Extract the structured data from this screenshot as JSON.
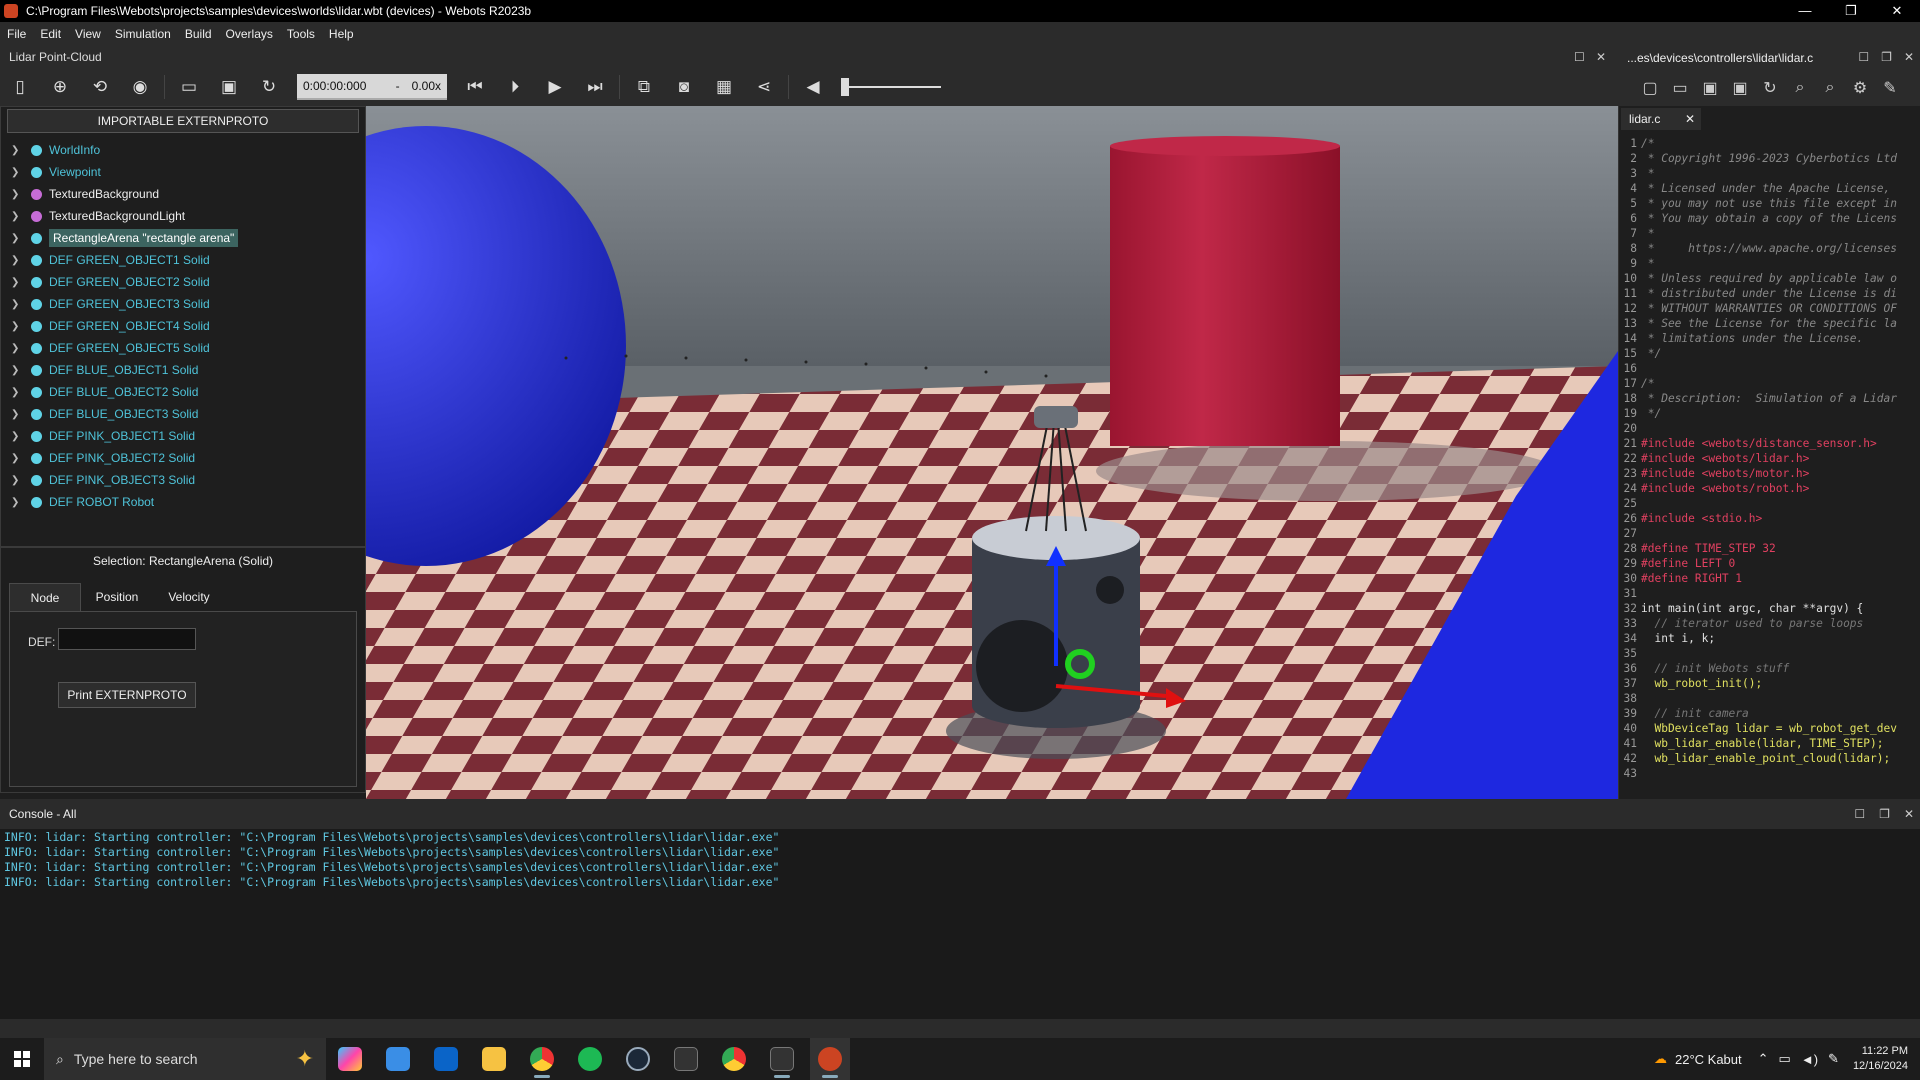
{
  "window": {
    "title": "C:\\Program Files\\Webots\\projects\\samples\\devices\\worlds\\lidar.wbt (devices) - Webots R2023b"
  },
  "menu": [
    "File",
    "Edit",
    "View",
    "Simulation",
    "Build",
    "Overlays",
    "Tools",
    "Help"
  ],
  "view": {
    "title": "Lidar Point-Cloud"
  },
  "toolbar": {
    "time": "0:00:00:000",
    "dash": "-",
    "speed": "0.00x"
  },
  "scene_tree": {
    "extern_button": "IMPORTABLE EXTERNPROTO",
    "items": [
      {
        "label": "WorldInfo",
        "style": "cyan"
      },
      {
        "label": "Viewpoint",
        "style": "cyan"
      },
      {
        "label": "TexturedBackground",
        "style": "white"
      },
      {
        "label": "TexturedBackgroundLight",
        "style": "white"
      },
      {
        "label": "RectangleArena \"rectangle arena\"",
        "style": "selected"
      },
      {
        "label": "DEF GREEN_OBJECT1 Solid",
        "style": "cyan"
      },
      {
        "label": "DEF GREEN_OBJECT2 Solid",
        "style": "cyan"
      },
      {
        "label": "DEF GREEN_OBJECT3 Solid",
        "style": "cyan"
      },
      {
        "label": "DEF GREEN_OBJECT4 Solid",
        "style": "cyan"
      },
      {
        "label": "DEF GREEN_OBJECT5 Solid",
        "style": "cyan"
      },
      {
        "label": "DEF BLUE_OBJECT1 Solid",
        "style": "cyan"
      },
      {
        "label": "DEF BLUE_OBJECT2 Solid",
        "style": "cyan"
      },
      {
        "label": "DEF BLUE_OBJECT3 Solid",
        "style": "cyan"
      },
      {
        "label": "DEF PINK_OBJECT1 Solid",
        "style": "cyan"
      },
      {
        "label": "DEF PINK_OBJECT2 Solid",
        "style": "cyan"
      },
      {
        "label": "DEF PINK_OBJECT3 Solid",
        "style": "cyan"
      },
      {
        "label": "DEF ROBOT Robot",
        "style": "cyan"
      }
    ]
  },
  "selection": {
    "title": "Selection: RectangleArena (Solid)",
    "tabs": [
      "Node",
      "Position",
      "Velocity"
    ],
    "def_label": "DEF:",
    "def_value": "",
    "print_button": "Print EXTERNPROTO"
  },
  "editor": {
    "title": "...es\\devices\\controllers\\lidar\\lidar.c",
    "tab": "lidar.c",
    "lines": [
      {
        "n": "1",
        "cls": "cm",
        "t": "/*"
      },
      {
        "n": "2",
        "cls": "cm",
        "t": " * Copyright 1996-2023 Cyberbotics Ltd"
      },
      {
        "n": "3",
        "cls": "cm",
        "t": " *"
      },
      {
        "n": "4",
        "cls": "cm",
        "t": " * Licensed under the Apache License,"
      },
      {
        "n": "5",
        "cls": "cm",
        "t": " * you may not use this file except in"
      },
      {
        "n": "6",
        "cls": "cm",
        "t": " * You may obtain a copy of the Licens"
      },
      {
        "n": "7",
        "cls": "cm",
        "t": " *"
      },
      {
        "n": "8",
        "cls": "cm",
        "t": " *     https://www.apache.org/licenses"
      },
      {
        "n": "9",
        "cls": "cm",
        "t": " *"
      },
      {
        "n": "10",
        "cls": "cm",
        "t": " * Unless required by applicable law o"
      },
      {
        "n": "11",
        "cls": "cm",
        "t": " * distributed under the License is di"
      },
      {
        "n": "12",
        "cls": "cm",
        "t": " * WITHOUT WARRANTIES OR CONDITIONS OF"
      },
      {
        "n": "13",
        "cls": "cm",
        "t": " * See the License for the specific la"
      },
      {
        "n": "14",
        "cls": "cm",
        "t": " * limitations under the License."
      },
      {
        "n": "15",
        "cls": "cm",
        "t": " */"
      },
      {
        "n": "16",
        "cls": "tx",
        "t": ""
      },
      {
        "n": "17",
        "cls": "cm",
        "t": "/*"
      },
      {
        "n": "18",
        "cls": "cm",
        "t": " * Description:  Simulation of a Lidar"
      },
      {
        "n": "19",
        "cls": "cm",
        "t": " */"
      },
      {
        "n": "20",
        "cls": "tx",
        "t": ""
      },
      {
        "n": "21",
        "cls": "pp",
        "t": "#include <webots/distance_sensor.h>"
      },
      {
        "n": "22",
        "cls": "pp",
        "t": "#include <webots/lidar.h>"
      },
      {
        "n": "23",
        "cls": "pp",
        "t": "#include <webots/motor.h>"
      },
      {
        "n": "24",
        "cls": "pp",
        "t": "#include <webots/robot.h>"
      },
      {
        "n": "25",
        "cls": "tx",
        "t": ""
      },
      {
        "n": "26",
        "cls": "pp",
        "t": "#include <stdio.h>"
      },
      {
        "n": "27",
        "cls": "tx",
        "t": ""
      },
      {
        "n": "28",
        "cls": "pp",
        "t": "#define TIME_STEP 32"
      },
      {
        "n": "29",
        "cls": "pp",
        "t": "#define LEFT 0"
      },
      {
        "n": "30",
        "cls": "pp",
        "t": "#define RIGHT 1"
      },
      {
        "n": "31",
        "cls": "tx",
        "t": ""
      },
      {
        "n": "32",
        "cls": "tx",
        "t": "int main(int argc, char **argv) {"
      },
      {
        "n": "33",
        "cls": "cmt2",
        "t": "  // iterator used to parse loops"
      },
      {
        "n": "34",
        "cls": "tx",
        "t": "  int i, k;"
      },
      {
        "n": "35",
        "cls": "tx",
        "t": ""
      },
      {
        "n": "36",
        "cls": "cmt2",
        "t": "  // init Webots stuff"
      },
      {
        "n": "37",
        "cls": "fn",
        "t": "  wb_robot_init();"
      },
      {
        "n": "38",
        "cls": "tx",
        "t": ""
      },
      {
        "n": "39",
        "cls": "cmt2",
        "t": "  // init camera"
      },
      {
        "n": "40",
        "cls": "fn",
        "t": "  WbDeviceTag lidar = wb_robot_get_dev"
      },
      {
        "n": "41",
        "cls": "fn",
        "t": "  wb_lidar_enable(lidar, TIME_STEP);"
      },
      {
        "n": "42",
        "cls": "fn",
        "t": "  wb_lidar_enable_point_cloud(lidar);"
      },
      {
        "n": "43",
        "cls": "tx",
        "t": ""
      }
    ]
  },
  "console": {
    "title": "Console - All",
    "lines": [
      "INFO: lidar: Starting controller: \"C:\\Program Files\\Webots\\projects\\samples\\devices\\controllers\\lidar\\lidar.exe\"",
      "INFO: lidar: Starting controller: \"C:\\Program Files\\Webots\\projects\\samples\\devices\\controllers\\lidar\\lidar.exe\"",
      "INFO: lidar: Starting controller: \"C:\\Program Files\\Webots\\projects\\samples\\devices\\controllers\\lidar\\lidar.exe\"",
      "INFO: lidar: Starting controller: \"C:\\Program Files\\Webots\\projects\\samples\\devices\\controllers\\lidar\\lidar.exe\""
    ]
  },
  "taskbar": {
    "search_placeholder": "Type here to search",
    "weather": "22°C  Kabut",
    "time": "11:22 PM",
    "date": "12/16/2024"
  },
  "colors": {
    "accent": "#5fd3e6",
    "selected": "#3c6460",
    "red_cylinder": "#b02040",
    "blue_object": "#2a30d8"
  }
}
